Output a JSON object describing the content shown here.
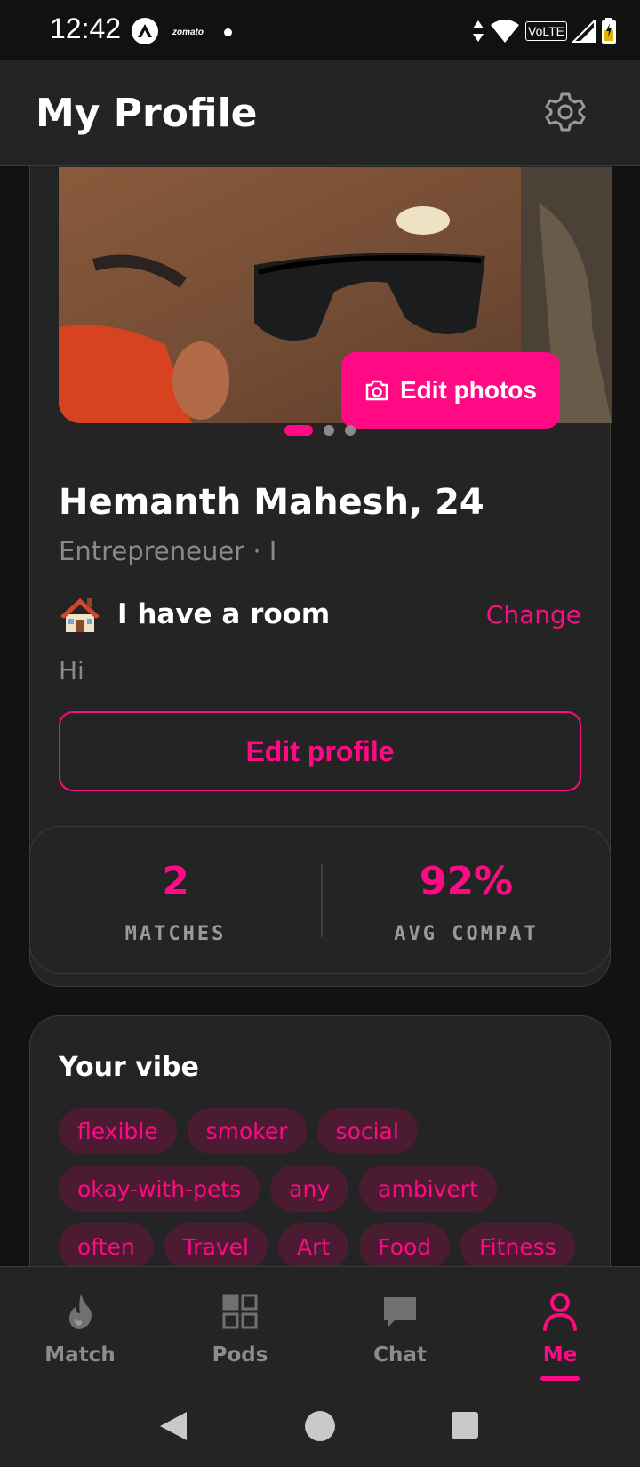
{
  "status_bar": {
    "time": "12:42",
    "app_label": "zomato",
    "network": "VoLTE"
  },
  "header": {
    "title": "My Profile",
    "settings_icon": "gear-icon"
  },
  "profile": {
    "edit_photos_label": "Edit photos",
    "photo_count": 3,
    "active_photo": 1,
    "name_age": "Hemanth Mahesh, 24",
    "occupation": "Entrepreneuer · I",
    "room_status": "I have a room",
    "room_icon": "house-icon",
    "change_label": "Change",
    "bio": "Hi",
    "edit_profile_label": "Edit profile"
  },
  "stats": [
    {
      "value": "2",
      "label": "MATCHES"
    },
    {
      "value": "92%",
      "label": "AVG COMPAT"
    }
  ],
  "vibe": {
    "title": "Your vibe",
    "tags": [
      "flexible",
      "smoker",
      "social",
      "okay-with-pets",
      "any",
      "ambivert",
      "often",
      "Travel",
      "Art",
      "Food",
      "Fitness"
    ]
  },
  "bottom_nav": [
    {
      "label": "Match",
      "icon": "flame-icon",
      "active": false
    },
    {
      "label": "Pods",
      "icon": "grid-icon",
      "active": false
    },
    {
      "label": "Chat",
      "icon": "chat-icon",
      "active": false
    },
    {
      "label": "Me",
      "icon": "person-icon",
      "active": true
    }
  ],
  "colors": {
    "accent": "#ff0a84",
    "card": "#242424",
    "background": "#121212",
    "tag_bg": "#4b1b31",
    "muted": "#8a8a8a"
  }
}
